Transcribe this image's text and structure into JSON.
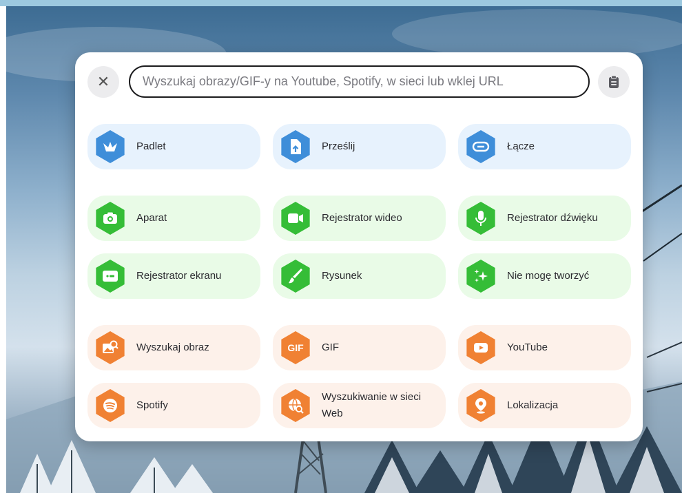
{
  "search": {
    "placeholder": "Wyszukaj obrazy/GIF-y na Youtube, Spotify, w sieci lub wklej URL",
    "close_icon": "close-icon",
    "paste_icon": "clipboard-icon"
  },
  "colors": {
    "blue": "#3f8ed9",
    "green": "#35bd37",
    "orange": "#f08133"
  },
  "tiles": [
    {
      "label": "Padlet",
      "icon": "padlet-bird-icon"
    },
    {
      "label": "Prześlij",
      "icon": "upload-file-icon"
    },
    {
      "label": "Łącze",
      "icon": "link-icon"
    },
    {
      "label": "Aparat",
      "icon": "camera-icon"
    },
    {
      "label": "Rejestrator wideo",
      "icon": "video-camera-icon"
    },
    {
      "label": "Rejestrator dźwięku",
      "icon": "microphone-icon"
    },
    {
      "label": "Rejestrator ekranu",
      "icon": "screen-record-icon"
    },
    {
      "label": "Rysunek",
      "icon": "brush-icon"
    },
    {
      "label": "Nie mogę tworzyć",
      "icon": "sparkles-icon"
    },
    {
      "label": "Wyszukaj obraz",
      "icon": "image-search-icon"
    },
    {
      "label": "GIF",
      "icon": "gif-icon",
      "badge_text": "GIF"
    },
    {
      "label": "YouTube",
      "icon": "youtube-icon"
    },
    {
      "label": "Spotify",
      "icon": "spotify-icon"
    },
    {
      "label": "Wyszukiwanie w sieci Web",
      "icon": "web-search-icon"
    },
    {
      "label": "Lokalizacja",
      "icon": "location-pin-icon"
    }
  ]
}
